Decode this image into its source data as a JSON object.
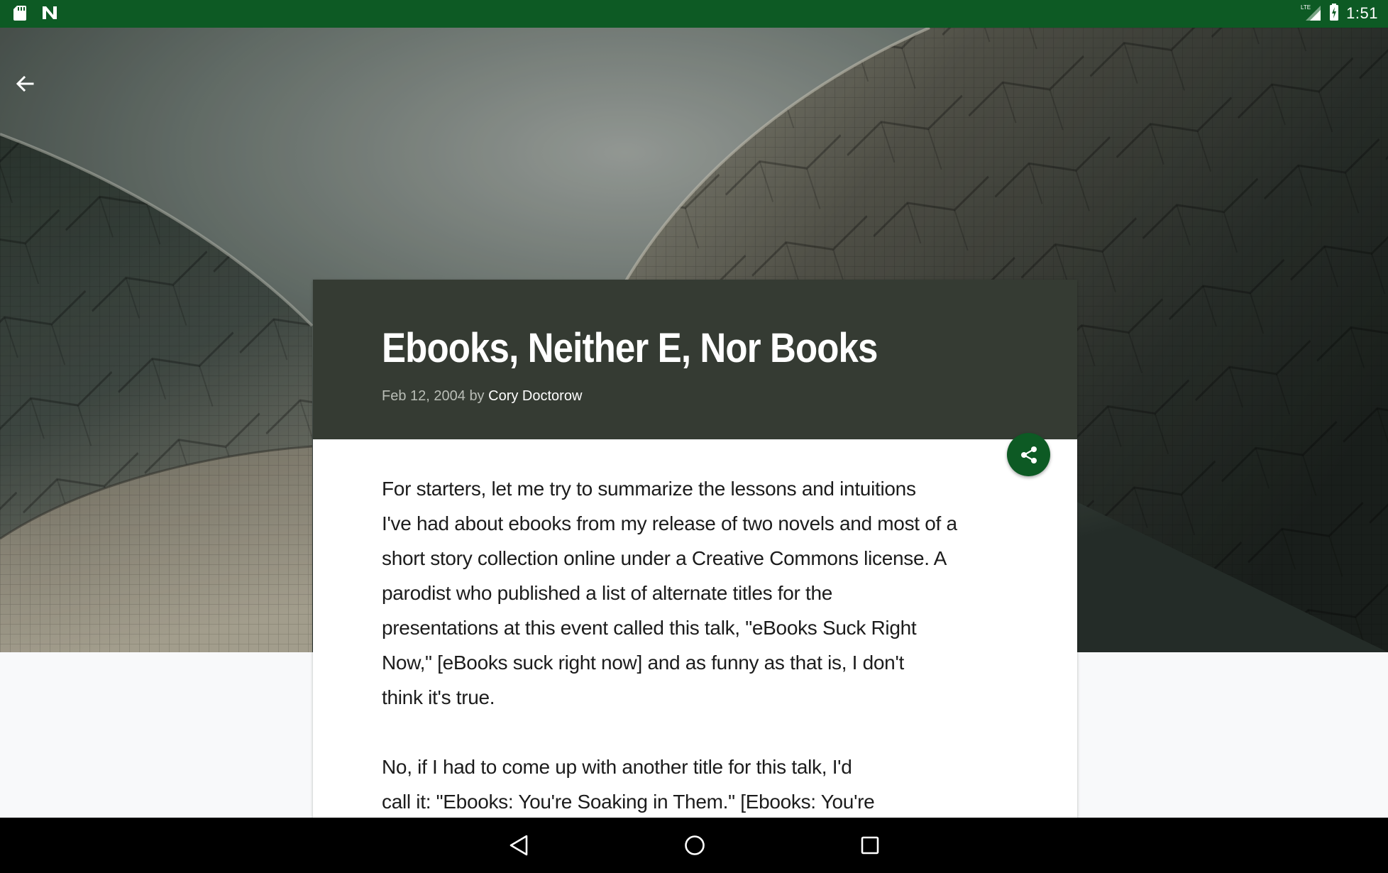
{
  "status_bar": {
    "time": "1:51",
    "left_icons": [
      "sd-card-icon",
      "n-notification-icon"
    ],
    "right_icons": [
      "lte-signal-icon",
      "battery-charging-icon"
    ],
    "background": "#0d5a24"
  },
  "toolbar": {
    "back_icon": "arrow-left-icon"
  },
  "article": {
    "title": "Ebooks, Neither E, Nor Books",
    "date": "Feb 12, 2004",
    "by": "by",
    "author": "Cory Doctorow",
    "paragraphs": [
      "For starters, let me try to summarize the lessons and intuitions\nI've had about ebooks from my release of two novels and most of a\nshort story collection online under a Creative Commons license. A\nparodist who published a list of alternate titles for the\npresentations at this event called this talk, \"eBooks Suck Right\nNow,\" [eBooks suck right now] and as funny as that is, I don't\nthink it's true.",
      "No, if I had to come up with another title for this talk, I'd\ncall it: \"Ebooks: You're Soaking in Them.\" [Ebooks: You're"
    ],
    "header_color": "#353b33",
    "share_icon": "share-icon",
    "accent_color": "#0d5a24"
  },
  "nav_bar": {
    "back_icon": "nav-back-icon",
    "home_icon": "nav-home-icon",
    "recents_icon": "nav-recents-icon"
  }
}
